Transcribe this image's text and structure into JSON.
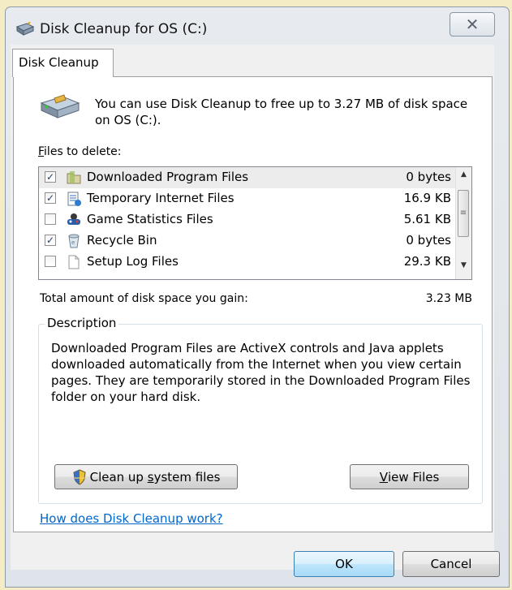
{
  "window": {
    "title": "Disk Cleanup for OS (C:)",
    "close_glyph": "✕"
  },
  "tabs": [
    {
      "label": "Disk Cleanup"
    }
  ],
  "intro_text": "You can use Disk Cleanup to free up to 3.27 MB of disk space on OS (C:).",
  "files_label": {
    "mnemonic": "F",
    "rest": "iles to delete:"
  },
  "files": [
    {
      "name": "Downloaded Program Files",
      "size": "0 bytes",
      "checked": true,
      "icon": "folder-icon"
    },
    {
      "name": "Temporary Internet Files",
      "size": "16.9 KB",
      "checked": true,
      "icon": "document-icon"
    },
    {
      "name": "Game Statistics Files",
      "size": "5.61 KB",
      "checked": false,
      "icon": "game-controller-icon"
    },
    {
      "name": "Recycle Bin",
      "size": "0 bytes",
      "checked": true,
      "icon": "recycle-bin-icon"
    },
    {
      "name": "Setup Log Files",
      "size": "29.3 KB",
      "checked": false,
      "icon": "blank-file-icon"
    }
  ],
  "total": {
    "label": "Total amount of disk space you gain:",
    "value": "3.23 MB"
  },
  "description": {
    "legend": "Description",
    "text": "Downloaded Program Files are ActiveX controls and Java applets downloaded automatically from the Internet when you view certain pages. They are temporarily stored in the Downloaded Program Files folder on your hard disk."
  },
  "buttons": {
    "cleanup_pre": "Clean up ",
    "cleanup_mnemonic": "s",
    "cleanup_post": "ystem files",
    "view_mnemonic": "V",
    "view_post": "iew Files",
    "ok": "OK",
    "cancel": "Cancel"
  },
  "help_link": "How does Disk Cleanup work?",
  "colors": {
    "link": "#0066cc",
    "checkmark": "#24406a"
  }
}
